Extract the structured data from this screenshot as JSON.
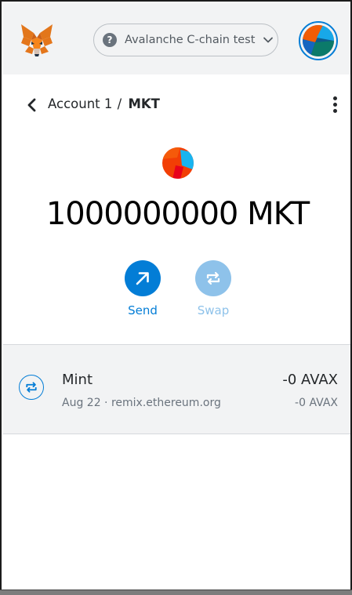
{
  "header": {
    "network": {
      "name": "Avalanche C-chain test",
      "help_glyph": "?"
    }
  },
  "breadcrumb": {
    "account": "Account 1",
    "separator": "/",
    "token": "MKT"
  },
  "asset": {
    "balance": "1000000000 MKT"
  },
  "actions": {
    "send_label": "Send",
    "swap_label": "Swap"
  },
  "transactions": [
    {
      "title": "Mint",
      "subtitle": "Aug 22 · remix.ethereum.org",
      "amount": "-0 AVAX",
      "amount_secondary": "-0 AVAX"
    }
  ],
  "colors": {
    "accent": "#037dd6",
    "accent_disabled": "#8ec2ea",
    "header_bg": "#f2f3f4",
    "list_bg": "#f2f3f4"
  },
  "icons": {
    "logo": "metamask-fox-icon",
    "network": "question-circle-icon",
    "dropdown": "chevron-down-icon",
    "back": "chevron-left-icon",
    "menu": "kebab-menu-icon",
    "send": "arrow-up-right-icon",
    "swap": "swap-arrows-icon",
    "tx": "swap-arrows-icon"
  }
}
